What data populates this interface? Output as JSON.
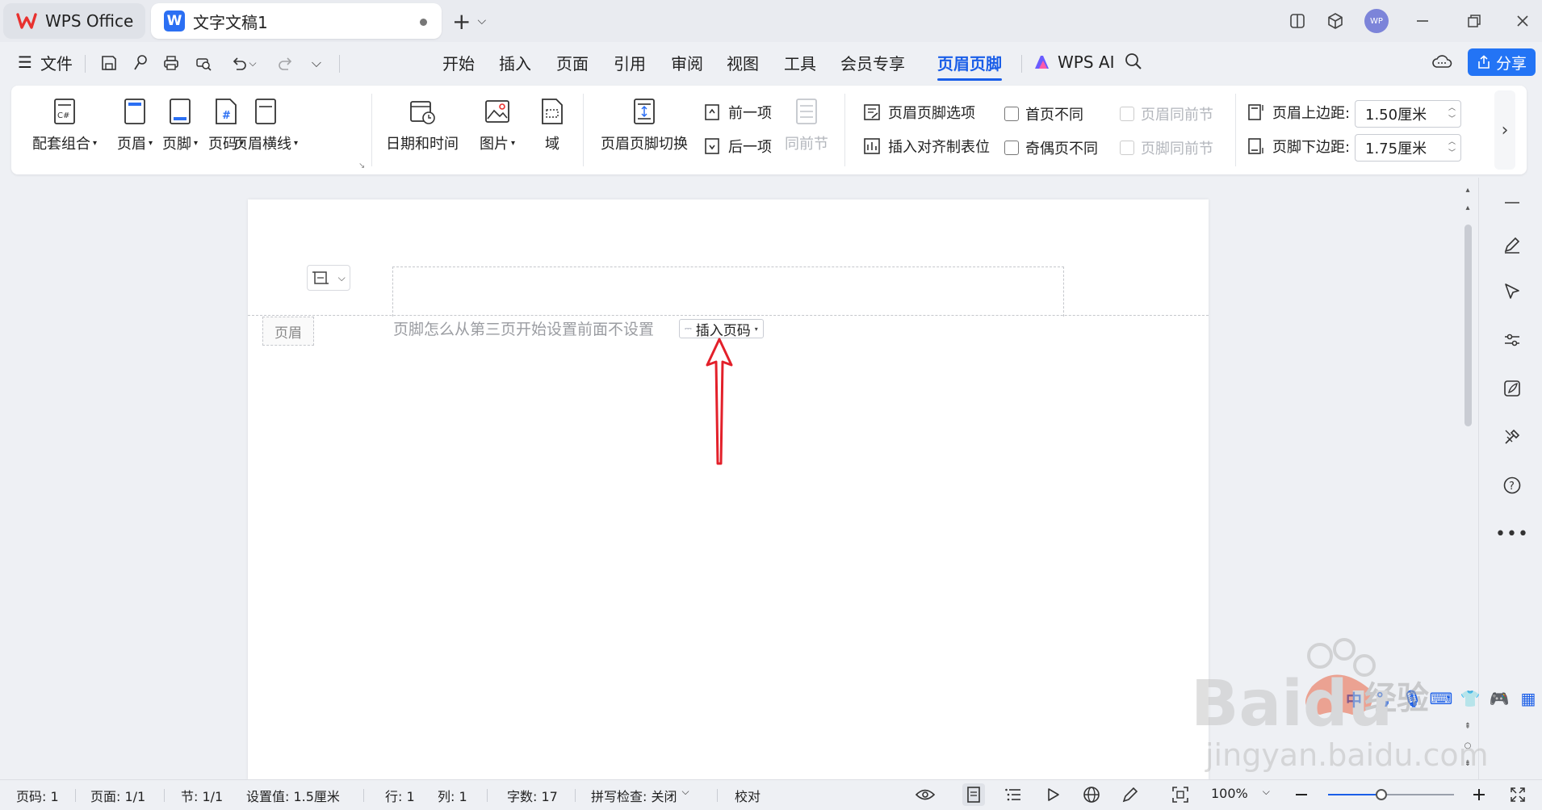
{
  "titlebar": {
    "wps_tab": "WPS Office",
    "doc_tab": "文字文稿1",
    "avatar_text": "WP",
    "colors": {
      "wps_red": "#e8312f",
      "doc_blue": "#2b6ff3"
    }
  },
  "menu": {
    "file": "文件",
    "items": [
      "开始",
      "插入",
      "页面",
      "引用",
      "审阅",
      "视图",
      "工具",
      "会员专享",
      "页眉页脚"
    ],
    "active": "页眉页脚",
    "ai": "WPS AI",
    "share": "分享"
  },
  "ribbon": {
    "peitao": "配套组合",
    "header": "页眉",
    "footer": "页脚",
    "pagenum": "页码",
    "hline": "页眉横线",
    "datetime": "日期和时间",
    "picture": "图片",
    "field": "域",
    "switch": "页眉页脚切换",
    "prev": "前一项",
    "next": "后一项",
    "same_prev": "同前节",
    "options": "页眉页脚选项",
    "align_tab": "插入对齐制表位",
    "first_diff": "首页不同",
    "odd_even": "奇偶页不同",
    "header_same": "页眉同前节",
    "footer_same": "页脚同前节",
    "top_margin_label": "页眉上边距:",
    "top_margin_value": "1.50厘米",
    "bottom_margin_label": "页脚下边距:",
    "bottom_margin_value": "1.75厘米"
  },
  "document": {
    "header_tag": "页眉",
    "header_text": "页脚怎么从第三页开始设置前面不设置",
    "insert_pagenum": "插入页码"
  },
  "statusbar": {
    "page_code": "页码: 1",
    "page": "页面: 1/1",
    "section": "节: 1/1",
    "setting": "设置值: 1.5厘米",
    "row": "行: 1",
    "col": "列: 1",
    "words": "字数: 17",
    "spell": "拼写检查: 关闭",
    "proof": "校对",
    "zoom": "100%",
    "zoom_fraction": 0.42
  },
  "ime": {
    "lang": "中"
  },
  "watermark": {
    "brand": "Baidu",
    "sub": "经验",
    "url": "jingyan.baidu.com"
  }
}
